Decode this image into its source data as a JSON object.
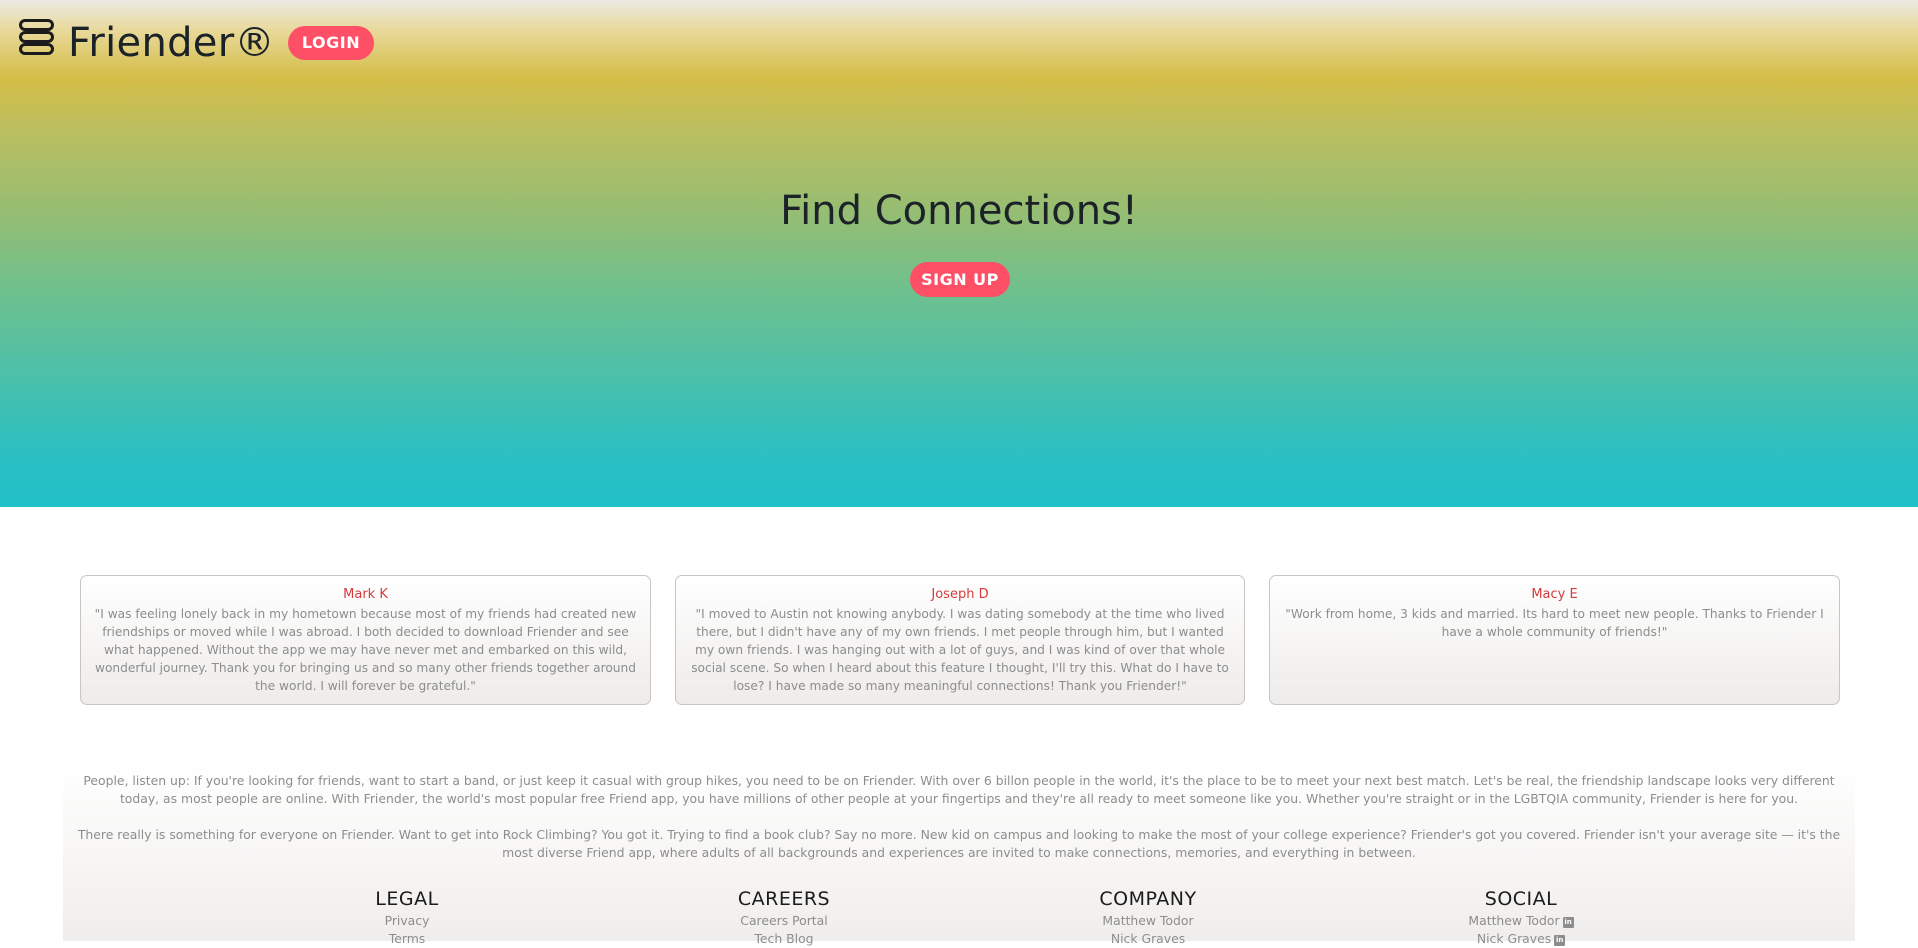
{
  "header": {
    "brand": "Friender®",
    "menu_icon": "stack-menu-icon",
    "login_label": "LOGIN"
  },
  "hero": {
    "title": "Find Connections!",
    "signup_label": "SIGN UP"
  },
  "colors": {
    "accent": "#fd4f66",
    "name": "#d63a3a",
    "hero_top": "#d4bd47",
    "hero_bottom": "#22c0c8"
  },
  "testimonials": [
    {
      "name": "Mark K",
      "quote": "\"I was feeling lonely back in my hometown because most of my friends had created new friendships or moved while I was abroad. I both decided to download Friender and see what happened. Without the app we may have never met and embarked on this wild, wonderful journey. Thank you for bringing us and so many other friends together around the world. I will forever be grateful.\""
    },
    {
      "name": "Joseph D",
      "quote": "\"I moved to Austin not knowing anybody. I was dating somebody at the time who lived there, but I didn't have any of my own friends. I met people through him, but I wanted my own friends. I was hanging out with a lot of guys, and I was kind of over that whole social scene. So when I heard about this feature I thought, I'll try this. What do I have to lose? I have made so many meaningful connections! Thank you Friender!\""
    },
    {
      "name": "Macy E",
      "quote": "\"Work from home, 3 kids and married. Its hard to meet new people. Thanks to Friender I have a whole community of friends!\""
    }
  ],
  "about": {
    "paragraph1": "People, listen up: If you're looking for friends, want to start a band, or just keep it casual with group hikes, you need to be on Friender. With over 6 billon people in the world, it's the place to be to meet your next best match. Let's be real, the friendship landscape looks very different today, as most people are online. With Friender, the world's most popular free Friend app, you have millions of other people at your fingertips and they're all ready to meet someone like you. Whether you're straight or in the LGBTQIA community, Friender is here for you.",
    "paragraph2": "There really is something for everyone on Friender. Want to get into Rock Climbing? You got it. Trying to find a book club? Say no more. New kid on campus and looking to make the most of your college experience? Friender's got you covered. Friender isn't your average site — it's the most diverse Friend app, where adults of all backgrounds and experiences are invited to make connections, memories, and everything in between."
  },
  "footer": {
    "legal": {
      "heading": "LEGAL",
      "links": [
        "Privacy",
        "Terms"
      ]
    },
    "careers": {
      "heading": "CAREERS",
      "links": [
        "Careers Portal",
        "Tech Blog"
      ]
    },
    "company": {
      "heading": "COMPANY",
      "links": [
        "Matthew Todor",
        "Nick Graves"
      ]
    },
    "social": {
      "heading": "SOCIAL",
      "links": [
        "Matthew Todor",
        "Nick Graves"
      ],
      "icon": "linkedin-icon",
      "icon_text": "in"
    }
  }
}
